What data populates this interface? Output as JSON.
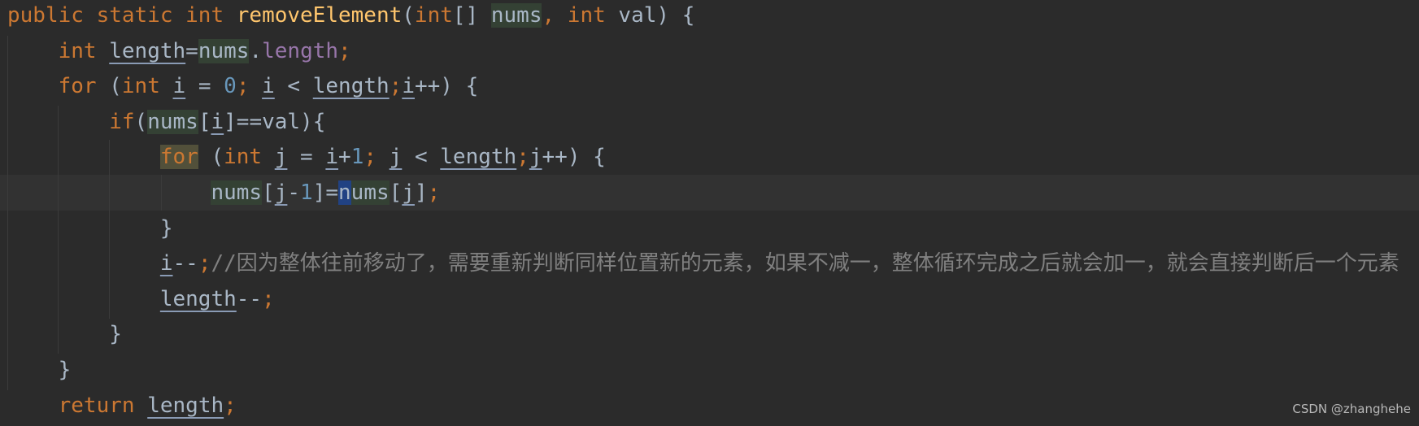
{
  "colors": {
    "background": "#2b2b2b",
    "current_line": "#323232",
    "keyword": "#cc7832",
    "identifier": "#a9b7c6",
    "method": "#ffc66d",
    "number": "#6897bb",
    "field": "#9876aa",
    "comment": "#808080",
    "usage_highlight": "#344134",
    "keyword_highlight": "#52503a",
    "caret_highlight": "#214283"
  },
  "code": {
    "lines": [
      [
        {
          "t": "public static int ",
          "c": "k"
        },
        {
          "t": "removeElement",
          "c": "m"
        },
        {
          "t": "(",
          "c": "i"
        },
        {
          "t": "int",
          "c": "k"
        },
        {
          "t": "[] ",
          "c": "i"
        },
        {
          "t": "nums",
          "c": "i",
          "h": "g"
        },
        {
          "t": ", ",
          "c": "k"
        },
        {
          "t": "int ",
          "c": "k"
        },
        {
          "t": "val) {",
          "c": "i"
        }
      ],
      [
        {
          "t": "    ",
          "c": "i"
        },
        {
          "t": "int ",
          "c": "k"
        },
        {
          "t": "length",
          "c": "i",
          "u": true
        },
        {
          "t": "=",
          "c": "i"
        },
        {
          "t": "nums",
          "c": "i",
          "h": "g"
        },
        {
          "t": ".",
          "c": "i"
        },
        {
          "t": "length",
          "c": "f"
        },
        {
          "t": ";",
          "c": "k"
        }
      ],
      [
        {
          "t": "    ",
          "c": "i"
        },
        {
          "t": "for ",
          "c": "k"
        },
        {
          "t": "(",
          "c": "i"
        },
        {
          "t": "int ",
          "c": "k"
        },
        {
          "t": "i",
          "c": "i",
          "u": true
        },
        {
          "t": " = ",
          "c": "i"
        },
        {
          "t": "0",
          "c": "n"
        },
        {
          "t": "; ",
          "c": "k"
        },
        {
          "t": "i",
          "c": "i",
          "u": true
        },
        {
          "t": " < ",
          "c": "i"
        },
        {
          "t": "length",
          "c": "i",
          "u": true
        },
        {
          "t": ";",
          "c": "k"
        },
        {
          "t": "i",
          "c": "i",
          "u": true
        },
        {
          "t": "++) {",
          "c": "i"
        }
      ],
      [
        {
          "t": "        ",
          "c": "i"
        },
        {
          "t": "if",
          "c": "k"
        },
        {
          "t": "(",
          "c": "i"
        },
        {
          "t": "nums",
          "c": "i",
          "h": "g"
        },
        {
          "t": "[",
          "c": "i"
        },
        {
          "t": "i",
          "c": "i",
          "u": true
        },
        {
          "t": "]==val){",
          "c": "i"
        }
      ],
      [
        {
          "t": "            ",
          "c": "i"
        },
        {
          "t": "for",
          "c": "k",
          "h": "y"
        },
        {
          "t": " (",
          "c": "i"
        },
        {
          "t": "int ",
          "c": "k"
        },
        {
          "t": "j",
          "c": "i",
          "u": true
        },
        {
          "t": " = ",
          "c": "i"
        },
        {
          "t": "i",
          "c": "i",
          "u": true
        },
        {
          "t": "+",
          "c": "i"
        },
        {
          "t": "1",
          "c": "n"
        },
        {
          "t": "; ",
          "c": "k"
        },
        {
          "t": "j",
          "c": "i",
          "u": true
        },
        {
          "t": " < ",
          "c": "i"
        },
        {
          "t": "length",
          "c": "i",
          "u": true
        },
        {
          "t": ";",
          "c": "k"
        },
        {
          "t": "j",
          "c": "i",
          "u": true
        },
        {
          "t": "++) {",
          "c": "i"
        }
      ],
      [
        {
          "t": "                ",
          "c": "i"
        },
        {
          "t": "nums",
          "c": "i",
          "h": "g"
        },
        {
          "t": "[",
          "c": "i"
        },
        {
          "t": "j",
          "c": "i",
          "u": true
        },
        {
          "t": "-",
          "c": "i"
        },
        {
          "t": "1",
          "c": "n"
        },
        {
          "t": "]=",
          "c": "i"
        },
        {
          "t": "n",
          "c": "i",
          "h": "b"
        },
        {
          "t": "ums",
          "c": "i",
          "h": "g"
        },
        {
          "t": "[",
          "c": "i"
        },
        {
          "t": "j",
          "c": "i",
          "u": true
        },
        {
          "t": "]",
          "c": "i"
        },
        {
          "t": ";",
          "c": "k"
        }
      ],
      [
        {
          "t": "            }",
          "c": "i"
        }
      ],
      [
        {
          "t": "            ",
          "c": "i"
        },
        {
          "t": "i",
          "c": "i",
          "u": true
        },
        {
          "t": "--",
          "c": "i"
        },
        {
          "t": ";",
          "c": "k"
        },
        {
          "t": "//因为整体往前移动了，需要重新判断同样位置新的元素，如果不减一，整体循环完成之后就会加一，就会直接判断后一个元素",
          "c": "c"
        }
      ],
      [
        {
          "t": "            ",
          "c": "i"
        },
        {
          "t": "length",
          "c": "i",
          "u": true
        },
        {
          "t": "--",
          "c": "i"
        },
        {
          "t": ";",
          "c": "k"
        }
      ],
      [
        {
          "t": "        }",
          "c": "i"
        }
      ],
      [
        {
          "t": "    }",
          "c": "i"
        }
      ],
      [
        {
          "t": "    ",
          "c": "i"
        },
        {
          "t": "return ",
          "c": "k"
        },
        {
          "t": "length",
          "c": "i",
          "u": true
        },
        {
          "t": ";",
          "c": "k"
        }
      ]
    ]
  },
  "watermark": "CSDN @zhanghehe"
}
